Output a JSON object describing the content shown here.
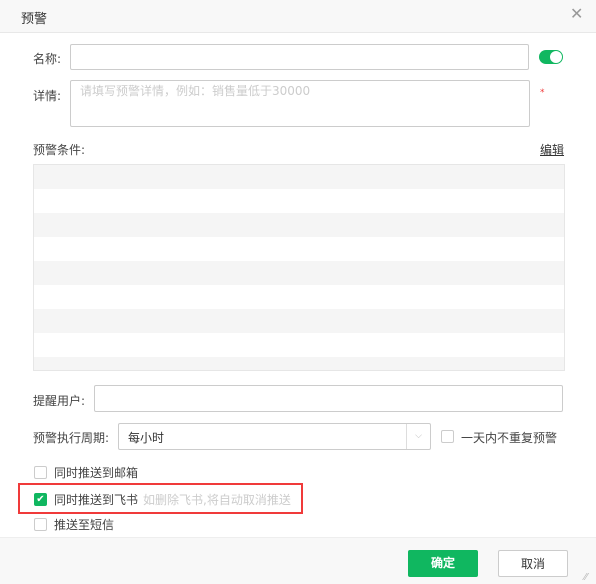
{
  "dialog": {
    "title": "预警",
    "close_icon": "close-icon"
  },
  "form": {
    "name_label": "名称:",
    "name_value": "",
    "toggle_on": true,
    "detail_label": "详情:",
    "detail_placeholder": "请填写预警详情，例如：销售量低于30000",
    "required_mark": "*",
    "condition_label": "预警条件:",
    "edit_link": "编辑",
    "remind_label": "提醒用户:",
    "remind_value": "",
    "period_label": "预警执行周期:",
    "period_value": "每小时",
    "no_repeat_label": "一天内不重复预警",
    "no_repeat_checked": false,
    "email_label": "同时推送到邮箱",
    "email_checked": false,
    "feishu_label": "同时推送到飞书",
    "feishu_checked": true,
    "feishu_hint": "如删除飞书,将自动取消推送",
    "sms_label": "推送至短信",
    "sms_checked": false
  },
  "footer": {
    "ok": "确定",
    "cancel": "取消"
  },
  "colors": {
    "accent": "#10b760",
    "highlight": "#f03a3a"
  }
}
